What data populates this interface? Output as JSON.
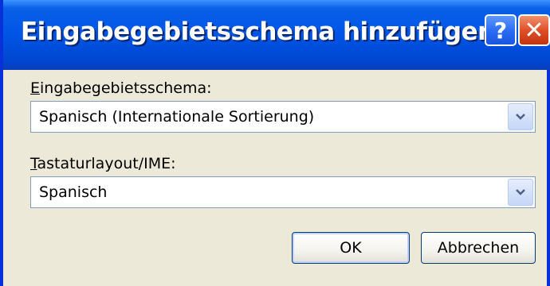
{
  "dialog": {
    "title": "Eingabegebietsschema hinzufügen",
    "help_glyph": "?",
    "close_glyph": "✕"
  },
  "locale": {
    "label_mnemonic": "E",
    "label_rest": "ingabegebietsschema:",
    "value": "Spanisch (Internationale Sortierung)"
  },
  "keyboard": {
    "label_mnemonic": "T",
    "label_rest": "astaturlayout/IME:",
    "value": "Spanisch"
  },
  "buttons": {
    "ok": "OK",
    "cancel": "Abbrechen"
  },
  "icons": {
    "help": "help-icon",
    "close": "close-icon",
    "dropdown": "chevron-down-icon"
  },
  "colors": {
    "titlebar": "#0055e5",
    "window_border": "#0831d9",
    "dialog_bg": "#ece9d8",
    "close_button": "#e0502a",
    "help_button": "#2c6ef5"
  }
}
